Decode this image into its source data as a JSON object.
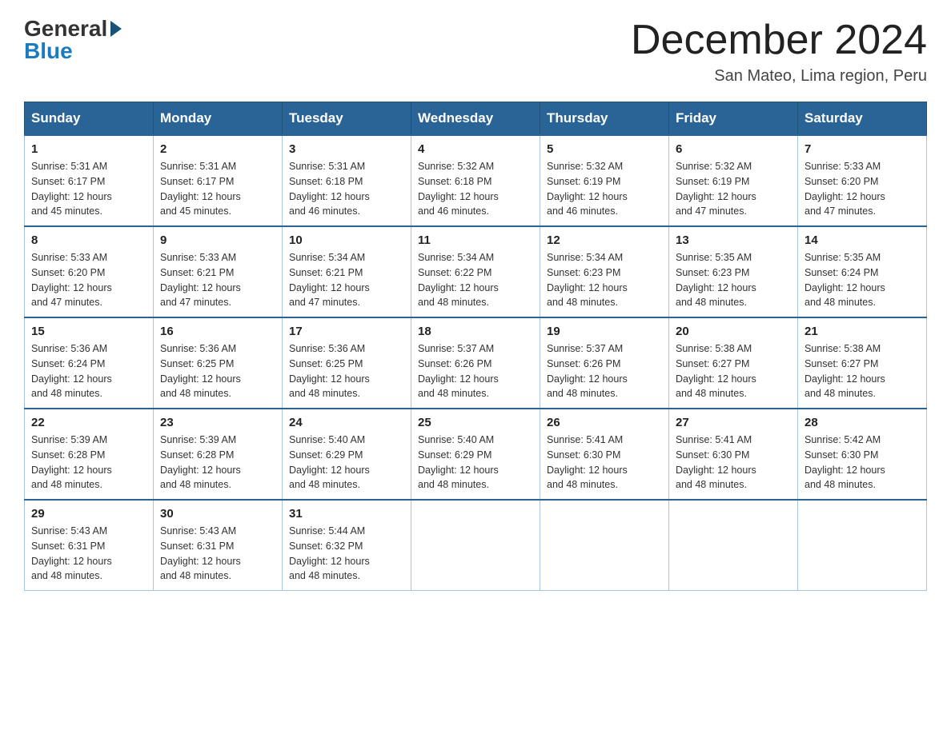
{
  "header": {
    "logo_general": "General",
    "logo_blue": "Blue",
    "month_title": "December 2024",
    "subtitle": "San Mateo, Lima region, Peru"
  },
  "days_of_week": [
    "Sunday",
    "Monday",
    "Tuesday",
    "Wednesday",
    "Thursday",
    "Friday",
    "Saturday"
  ],
  "weeks": [
    [
      {
        "day": "1",
        "sunrise": "5:31 AM",
        "sunset": "6:17 PM",
        "daylight": "12 hours and 45 minutes."
      },
      {
        "day": "2",
        "sunrise": "5:31 AM",
        "sunset": "6:17 PM",
        "daylight": "12 hours and 45 minutes."
      },
      {
        "day": "3",
        "sunrise": "5:31 AM",
        "sunset": "6:18 PM",
        "daylight": "12 hours and 46 minutes."
      },
      {
        "day": "4",
        "sunrise": "5:32 AM",
        "sunset": "6:18 PM",
        "daylight": "12 hours and 46 minutes."
      },
      {
        "day": "5",
        "sunrise": "5:32 AM",
        "sunset": "6:19 PM",
        "daylight": "12 hours and 46 minutes."
      },
      {
        "day": "6",
        "sunrise": "5:32 AM",
        "sunset": "6:19 PM",
        "daylight": "12 hours and 47 minutes."
      },
      {
        "day": "7",
        "sunrise": "5:33 AM",
        "sunset": "6:20 PM",
        "daylight": "12 hours and 47 minutes."
      }
    ],
    [
      {
        "day": "8",
        "sunrise": "5:33 AM",
        "sunset": "6:20 PM",
        "daylight": "12 hours and 47 minutes."
      },
      {
        "day": "9",
        "sunrise": "5:33 AM",
        "sunset": "6:21 PM",
        "daylight": "12 hours and 47 minutes."
      },
      {
        "day": "10",
        "sunrise": "5:34 AM",
        "sunset": "6:21 PM",
        "daylight": "12 hours and 47 minutes."
      },
      {
        "day": "11",
        "sunrise": "5:34 AM",
        "sunset": "6:22 PM",
        "daylight": "12 hours and 48 minutes."
      },
      {
        "day": "12",
        "sunrise": "5:34 AM",
        "sunset": "6:23 PM",
        "daylight": "12 hours and 48 minutes."
      },
      {
        "day": "13",
        "sunrise": "5:35 AM",
        "sunset": "6:23 PM",
        "daylight": "12 hours and 48 minutes."
      },
      {
        "day": "14",
        "sunrise": "5:35 AM",
        "sunset": "6:24 PM",
        "daylight": "12 hours and 48 minutes."
      }
    ],
    [
      {
        "day": "15",
        "sunrise": "5:36 AM",
        "sunset": "6:24 PM",
        "daylight": "12 hours and 48 minutes."
      },
      {
        "day": "16",
        "sunrise": "5:36 AM",
        "sunset": "6:25 PM",
        "daylight": "12 hours and 48 minutes."
      },
      {
        "day": "17",
        "sunrise": "5:36 AM",
        "sunset": "6:25 PM",
        "daylight": "12 hours and 48 minutes."
      },
      {
        "day": "18",
        "sunrise": "5:37 AM",
        "sunset": "6:26 PM",
        "daylight": "12 hours and 48 minutes."
      },
      {
        "day": "19",
        "sunrise": "5:37 AM",
        "sunset": "6:26 PM",
        "daylight": "12 hours and 48 minutes."
      },
      {
        "day": "20",
        "sunrise": "5:38 AM",
        "sunset": "6:27 PM",
        "daylight": "12 hours and 48 minutes."
      },
      {
        "day": "21",
        "sunrise": "5:38 AM",
        "sunset": "6:27 PM",
        "daylight": "12 hours and 48 minutes."
      }
    ],
    [
      {
        "day": "22",
        "sunrise": "5:39 AM",
        "sunset": "6:28 PM",
        "daylight": "12 hours and 48 minutes."
      },
      {
        "day": "23",
        "sunrise": "5:39 AM",
        "sunset": "6:28 PM",
        "daylight": "12 hours and 48 minutes."
      },
      {
        "day": "24",
        "sunrise": "5:40 AM",
        "sunset": "6:29 PM",
        "daylight": "12 hours and 48 minutes."
      },
      {
        "day": "25",
        "sunrise": "5:40 AM",
        "sunset": "6:29 PM",
        "daylight": "12 hours and 48 minutes."
      },
      {
        "day": "26",
        "sunrise": "5:41 AM",
        "sunset": "6:30 PM",
        "daylight": "12 hours and 48 minutes."
      },
      {
        "day": "27",
        "sunrise": "5:41 AM",
        "sunset": "6:30 PM",
        "daylight": "12 hours and 48 minutes."
      },
      {
        "day": "28",
        "sunrise": "5:42 AM",
        "sunset": "6:30 PM",
        "daylight": "12 hours and 48 minutes."
      }
    ],
    [
      {
        "day": "29",
        "sunrise": "5:43 AM",
        "sunset": "6:31 PM",
        "daylight": "12 hours and 48 minutes."
      },
      {
        "day": "30",
        "sunrise": "5:43 AM",
        "sunset": "6:31 PM",
        "daylight": "12 hours and 48 minutes."
      },
      {
        "day": "31",
        "sunrise": "5:44 AM",
        "sunset": "6:32 PM",
        "daylight": "12 hours and 48 minutes."
      },
      null,
      null,
      null,
      null
    ]
  ],
  "labels": {
    "sunrise": "Sunrise:",
    "sunset": "Sunset:",
    "daylight": "Daylight:"
  }
}
